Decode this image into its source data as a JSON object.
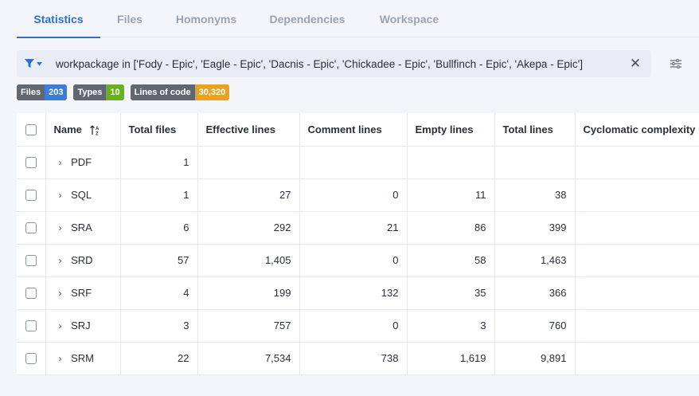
{
  "tabs": [
    {
      "label": "Statistics",
      "active": true
    },
    {
      "label": "Files",
      "active": false
    },
    {
      "label": "Homonyms",
      "active": false
    },
    {
      "label": "Dependencies",
      "active": false
    },
    {
      "label": "Workspace",
      "active": false
    }
  ],
  "filter": {
    "query": "workpackage in ['Fody - Epic', 'Eagle - Epic', 'Dacnis - Epic', 'Chickadee - Epic', 'Bullfinch - Epic', 'Akepa - Epic']",
    "filter_icon": "funnel-icon",
    "clear_label": "✕",
    "settings_icon": "sliders-icon"
  },
  "badges": [
    {
      "label": "Files",
      "value": "203",
      "color": "#3b7dd8"
    },
    {
      "label": "Types",
      "value": "10",
      "color": "#6ab023"
    },
    {
      "label": "Lines of code",
      "value": "30,320",
      "color": "#e8a21f"
    }
  ],
  "table": {
    "columns": [
      "Name",
      "Total files",
      "Effective lines",
      "Comment lines",
      "Empty lines",
      "Total lines",
      "Cyclomatic complexity"
    ],
    "rows": [
      {
        "name": "PDF",
        "total_files": "1",
        "effective": "",
        "comment": "",
        "empty": "",
        "total": "",
        "cyclomatic": ""
      },
      {
        "name": "SQL",
        "total_files": "1",
        "effective": "27",
        "comment": "0",
        "empty": "11",
        "total": "38",
        "cyclomatic": ""
      },
      {
        "name": "SRA",
        "total_files": "6",
        "effective": "292",
        "comment": "21",
        "empty": "86",
        "total": "399",
        "cyclomatic": ""
      },
      {
        "name": "SRD",
        "total_files": "57",
        "effective": "1,405",
        "comment": "0",
        "empty": "58",
        "total": "1,463",
        "cyclomatic": ""
      },
      {
        "name": "SRF",
        "total_files": "4",
        "effective": "199",
        "comment": "132",
        "empty": "35",
        "total": "366",
        "cyclomatic": ""
      },
      {
        "name": "SRJ",
        "total_files": "3",
        "effective": "757",
        "comment": "0",
        "empty": "3",
        "total": "760",
        "cyclomatic": ""
      },
      {
        "name": "SRM",
        "total_files": "22",
        "effective": "7,534",
        "comment": "738",
        "empty": "1,619",
        "total": "9,891",
        "cyclomatic": ""
      }
    ]
  }
}
